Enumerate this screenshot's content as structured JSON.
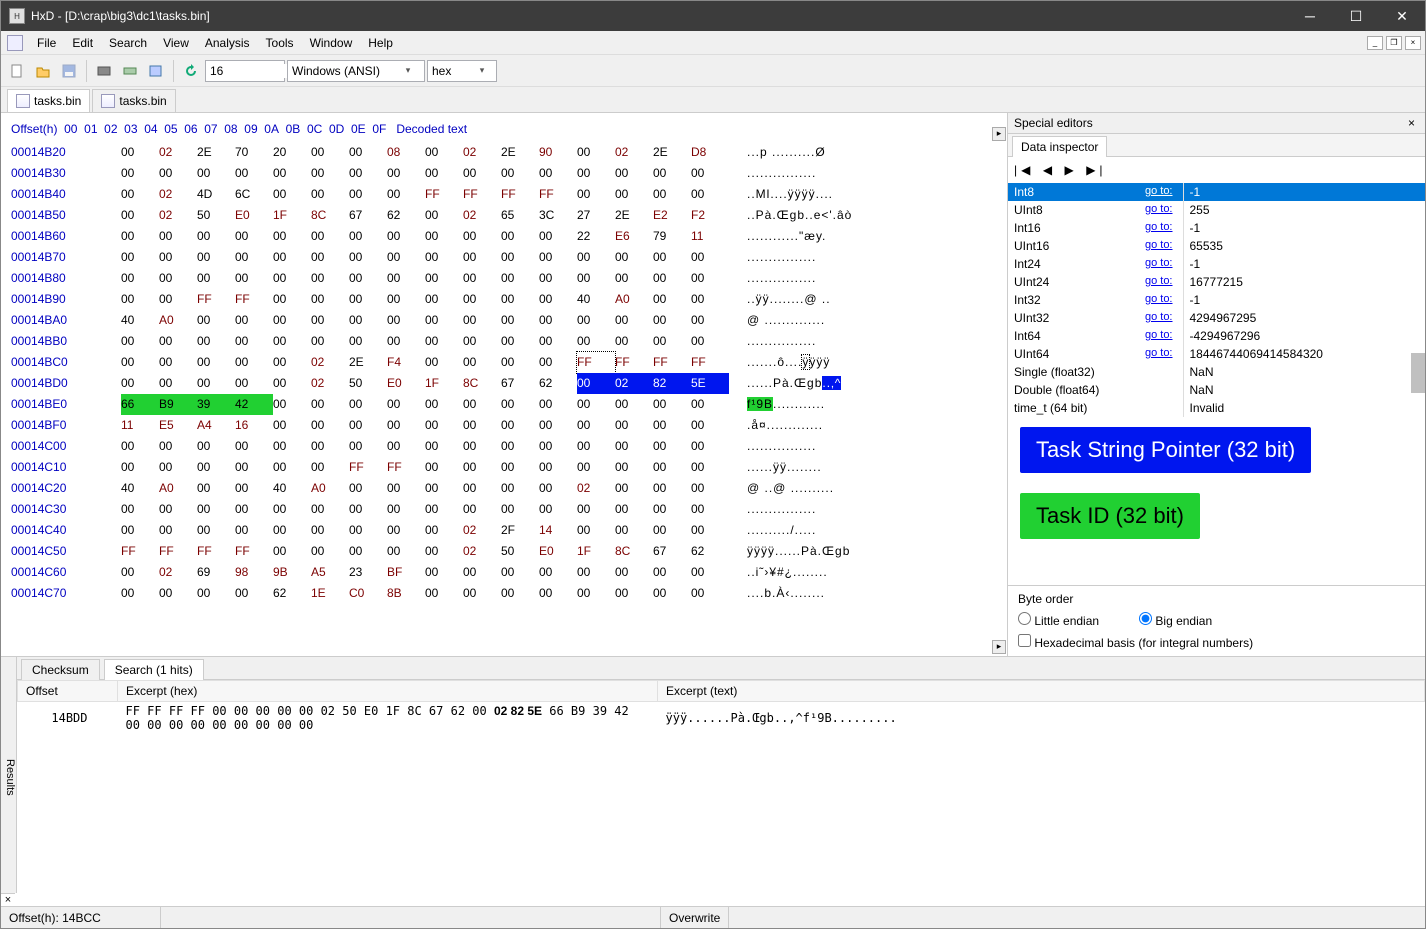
{
  "title": "HxD - [D:\\crap\\big3\\dc1\\tasks.bin]",
  "menu": [
    "File",
    "Edit",
    "Search",
    "View",
    "Analysis",
    "Tools",
    "Window",
    "Help"
  ],
  "toolbar": {
    "bytesPerRow": "16",
    "encoding": "Windows (ANSI)",
    "base": "hex"
  },
  "tabs": [
    "tasks.bin",
    "tasks.bin"
  ],
  "sidepanel": {
    "title": "Special editors",
    "tab": "Data inspector",
    "rows": [
      {
        "k": "Int8",
        "v": "-1",
        "sel": true
      },
      {
        "k": "UInt8",
        "v": "255"
      },
      {
        "k": "Int16",
        "v": "-1"
      },
      {
        "k": "UInt16",
        "v": "65535"
      },
      {
        "k": "Int24",
        "v": "-1"
      },
      {
        "k": "UInt24",
        "v": "16777215"
      },
      {
        "k": "Int32",
        "v": "-1"
      },
      {
        "k": "UInt32",
        "v": "4294967295"
      },
      {
        "k": "Int64",
        "v": "-4294967296"
      },
      {
        "k": "UInt64",
        "v": "18446744069414584320"
      },
      {
        "k": "Single (float32)",
        "v": "NaN"
      },
      {
        "k": "Double (float64)",
        "v": "NaN"
      },
      {
        "k": "time_t (64 bit)",
        "v": "Invalid"
      }
    ],
    "goto": "go to:",
    "annotBlue": "Task String Pointer (32 bit)",
    "annotGreen": "Task ID (32 bit)",
    "byteorder": {
      "label": "Byte order",
      "little": "Little endian",
      "big": "Big endian",
      "bigSelected": true
    },
    "hexbasis": "Hexadecimal basis (for integral numbers)"
  },
  "bottom": {
    "resultsLabel": "Results",
    "tabs": [
      "Checksum",
      "Search (1 hits)"
    ],
    "activeTab": 1,
    "cols": [
      "Offset",
      "Excerpt (hex)",
      "Excerpt (text)"
    ],
    "row": {
      "offset": "14BDD",
      "hex": "FF FF FF FF 00 00 00 00 00 02 50 E0 1F 8C 67 62 00 02 82 5E 66 B9 39 42 00 00 00 00 00 00 00 00 00",
      "text": "ÿÿÿ......Pà.Œgb..‚^f¹9B........."
    }
  },
  "status": {
    "left": "Offset(h): 14BCC",
    "right": "Overwrite"
  },
  "hex": {
    "header": "Offset(h)  00 01 02 03 04 05 06 07 08 09 0A 0B 0C 0D 0E 0F   Decoded text",
    "rows": [
      {
        "off": "00014B20",
        "b": [
          "00",
          "02",
          "2E",
          "70",
          "20",
          "00",
          "00",
          "08",
          "00",
          "02",
          "2E",
          "90",
          "00",
          "02",
          "2E",
          "D8"
        ],
        "t": "...p ..........Ø"
      },
      {
        "off": "00014B30",
        "b": [
          "00",
          "00",
          "00",
          "00",
          "00",
          "00",
          "00",
          "00",
          "00",
          "00",
          "00",
          "00",
          "00",
          "00",
          "00",
          "00"
        ],
        "t": "................"
      },
      {
        "off": "00014B40",
        "b": [
          "00",
          "02",
          "4D",
          "6C",
          "00",
          "00",
          "00",
          "00",
          "FF",
          "FF",
          "FF",
          "FF",
          "00",
          "00",
          "00",
          "00"
        ],
        "t": "..Ml....ÿÿÿÿ...."
      },
      {
        "off": "00014B50",
        "b": [
          "00",
          "02",
          "50",
          "E0",
          "1F",
          "8C",
          "67",
          "62",
          "00",
          "02",
          "65",
          "3C",
          "27",
          "2E",
          "E2",
          "F2"
        ],
        "t": "..Pà.Œgb..e<'.âò"
      },
      {
        "off": "00014B60",
        "b": [
          "00",
          "00",
          "00",
          "00",
          "00",
          "00",
          "00",
          "00",
          "00",
          "00",
          "00",
          "00",
          "22",
          "E6",
          "79",
          "11"
        ],
        "t": "............\"æy."
      },
      {
        "off": "00014B70",
        "b": [
          "00",
          "00",
          "00",
          "00",
          "00",
          "00",
          "00",
          "00",
          "00",
          "00",
          "00",
          "00",
          "00",
          "00",
          "00",
          "00"
        ],
        "t": "................"
      },
      {
        "off": "00014B80",
        "b": [
          "00",
          "00",
          "00",
          "00",
          "00",
          "00",
          "00",
          "00",
          "00",
          "00",
          "00",
          "00",
          "00",
          "00",
          "00",
          "00"
        ],
        "t": "................"
      },
      {
        "off": "00014B90",
        "b": [
          "00",
          "00",
          "FF",
          "FF",
          "00",
          "00",
          "00",
          "00",
          "00",
          "00",
          "00",
          "00",
          "40",
          "A0",
          "00",
          "00"
        ],
        "t": "..ÿÿ........@ .."
      },
      {
        "off": "00014BA0",
        "b": [
          "40",
          "A0",
          "00",
          "00",
          "00",
          "00",
          "00",
          "00",
          "00",
          "00",
          "00",
          "00",
          "00",
          "00",
          "00",
          "00"
        ],
        "t": "@ .............."
      },
      {
        "off": "00014BB0",
        "b": [
          "00",
          "00",
          "00",
          "00",
          "00",
          "00",
          "00",
          "00",
          "00",
          "00",
          "00",
          "00",
          "00",
          "00",
          "00",
          "00"
        ],
        "t": "................"
      },
      {
        "off": "00014BC0",
        "b": [
          "00",
          "00",
          "00",
          "00",
          "00",
          "02",
          "2E",
          "F4",
          "00",
          "00",
          "00",
          "00",
          "FF",
          "FF",
          "FF",
          "FF"
        ],
        "t": ".......ô....ÿÿÿÿ",
        "box": 12
      },
      {
        "off": "00014BD0",
        "b": [
          "00",
          "00",
          "00",
          "00",
          "00",
          "02",
          "50",
          "E0",
          "1F",
          "8C",
          "67",
          "62",
          "00",
          "02",
          "82",
          "5E"
        ],
        "t": "......Pà.Œgb..‚^",
        "blue": [
          12,
          15
        ]
      },
      {
        "off": "00014BE0",
        "b": [
          "66",
          "B9",
          "39",
          "42",
          "00",
          "00",
          "00",
          "00",
          "00",
          "00",
          "00",
          "00",
          "00",
          "00",
          "00",
          "00"
        ],
        "t": "f¹9B............",
        "green": [
          0,
          3
        ]
      },
      {
        "off": "00014BF0",
        "b": [
          "11",
          "E5",
          "A4",
          "16",
          "00",
          "00",
          "00",
          "00",
          "00",
          "00",
          "00",
          "00",
          "00",
          "00",
          "00",
          "00"
        ],
        "t": ".å¤............."
      },
      {
        "off": "00014C00",
        "b": [
          "00",
          "00",
          "00",
          "00",
          "00",
          "00",
          "00",
          "00",
          "00",
          "00",
          "00",
          "00",
          "00",
          "00",
          "00",
          "00"
        ],
        "t": "................"
      },
      {
        "off": "00014C10",
        "b": [
          "00",
          "00",
          "00",
          "00",
          "00",
          "00",
          "FF",
          "FF",
          "00",
          "00",
          "00",
          "00",
          "00",
          "00",
          "00",
          "00"
        ],
        "t": "......ÿÿ........"
      },
      {
        "off": "00014C20",
        "b": [
          "40",
          "A0",
          "00",
          "00",
          "40",
          "A0",
          "00",
          "00",
          "00",
          "00",
          "00",
          "00",
          "02",
          "00",
          "00",
          "00"
        ],
        "t": "@ ..@ .........."
      },
      {
        "off": "00014C30",
        "b": [
          "00",
          "00",
          "00",
          "00",
          "00",
          "00",
          "00",
          "00",
          "00",
          "00",
          "00",
          "00",
          "00",
          "00",
          "00",
          "00"
        ],
        "t": "................"
      },
      {
        "off": "00014C40",
        "b": [
          "00",
          "00",
          "00",
          "00",
          "00",
          "00",
          "00",
          "00",
          "00",
          "02",
          "2F",
          "14",
          "00",
          "00",
          "00",
          "00"
        ],
        "t": "........../....."
      },
      {
        "off": "00014C50",
        "b": [
          "FF",
          "FF",
          "FF",
          "FF",
          "00",
          "00",
          "00",
          "00",
          "00",
          "02",
          "50",
          "E0",
          "1F",
          "8C",
          "67",
          "62"
        ],
        "t": "ÿÿÿÿ......Pà.Œgb"
      },
      {
        "off": "00014C60",
        "b": [
          "00",
          "02",
          "69",
          "98",
          "9B",
          "A5",
          "23",
          "BF",
          "00",
          "00",
          "00",
          "00",
          "00",
          "00",
          "00",
          "00"
        ],
        "t": "..i˜›¥#¿........"
      },
      {
        "off": "00014C70",
        "b": [
          "00",
          "00",
          "00",
          "00",
          "62",
          "1E",
          "C0",
          "8B",
          "00",
          "00",
          "00",
          "00",
          "00",
          "00",
          "00",
          "00"
        ],
        "t": "....b.À‹........"
      }
    ]
  }
}
